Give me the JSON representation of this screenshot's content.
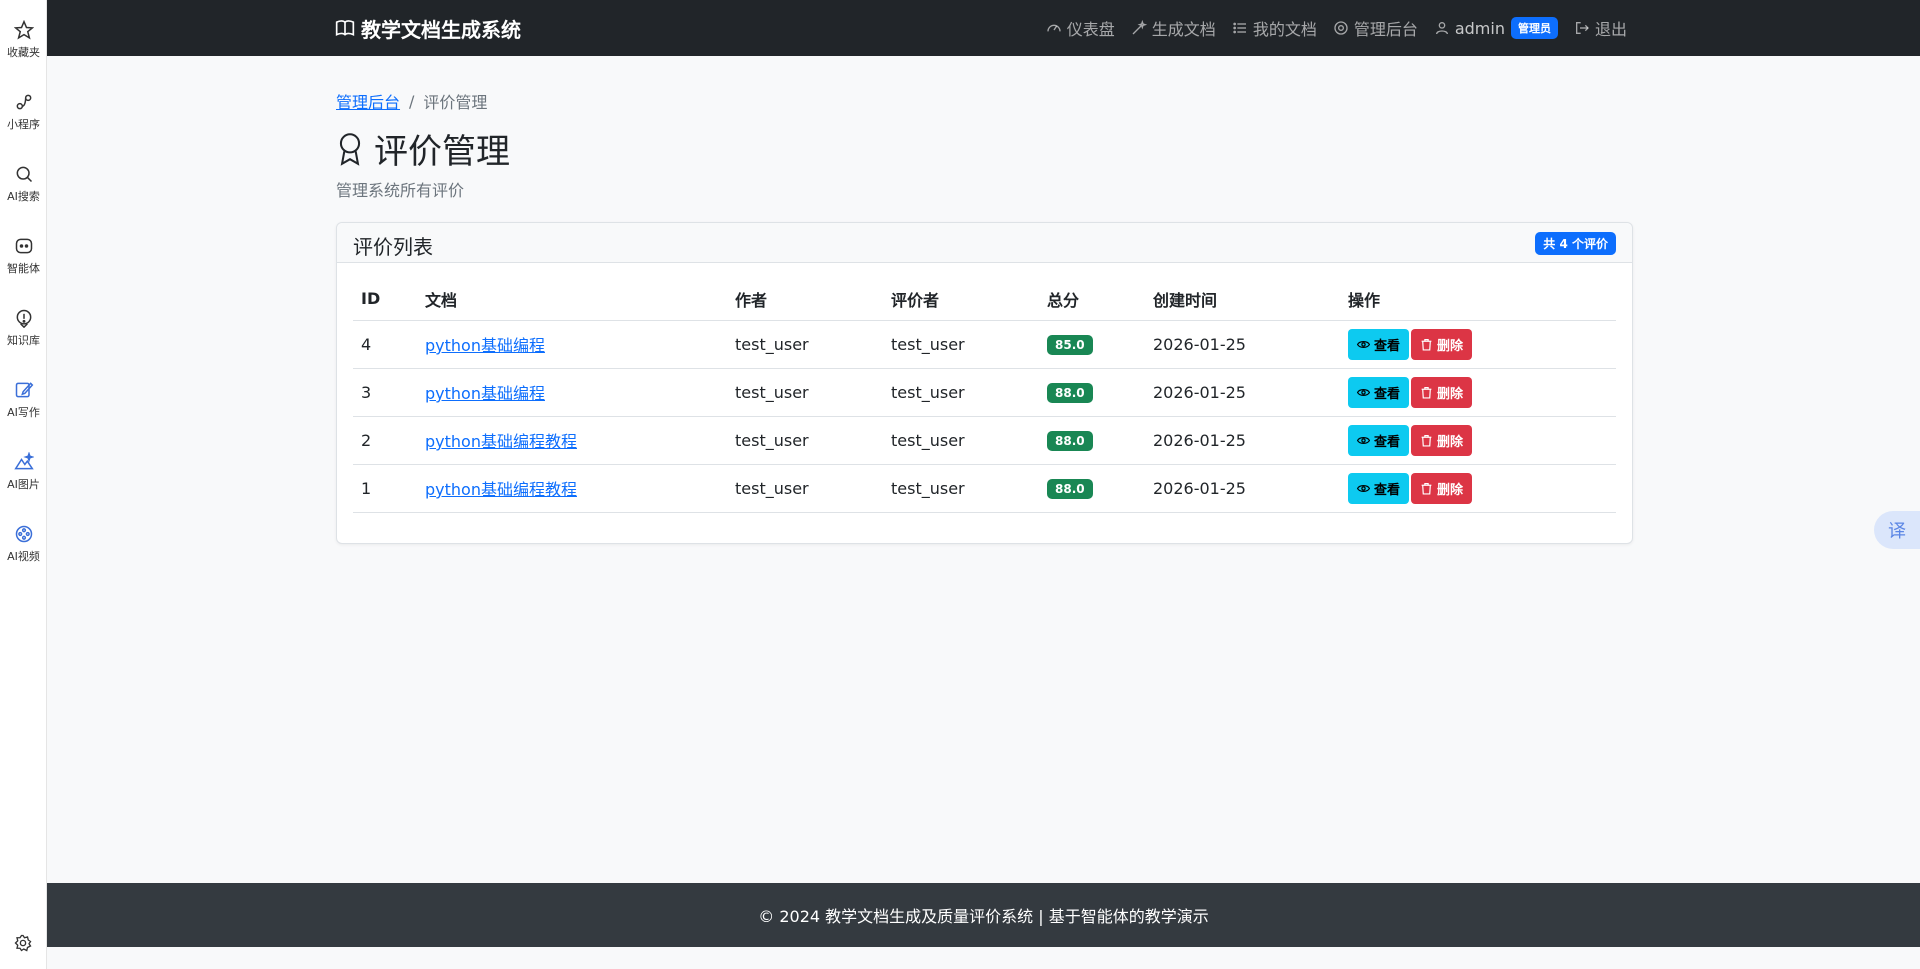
{
  "sidebar": {
    "items": [
      {
        "label": "收藏夹",
        "icon": "star-icon"
      },
      {
        "label": "小程序",
        "icon": "mini-program-icon"
      },
      {
        "label": "AI搜索",
        "icon": "search-icon"
      },
      {
        "label": "智能体",
        "icon": "agent-icon"
      },
      {
        "label": "知识库",
        "icon": "knowledge-icon"
      },
      {
        "label": "AI写作",
        "icon": "write-icon"
      },
      {
        "label": "AI图片",
        "icon": "image-icon"
      },
      {
        "label": "AI视频",
        "icon": "video-icon"
      }
    ],
    "settings_icon": "gear-icon"
  },
  "navbar": {
    "brand": "教学文档生成系统",
    "links": {
      "dashboard": "仪表盘",
      "generate": "生成文档",
      "my_docs": "我的文档",
      "admin": "管理后台",
      "user": "admin",
      "role": "管理员",
      "logout": "退出"
    }
  },
  "breadcrumb": {
    "parent": "管理后台",
    "separator": "/",
    "current": "评价管理"
  },
  "page": {
    "title": "评价管理",
    "subtitle": "管理系统所有评价"
  },
  "card": {
    "title": "评价列表",
    "count_badge": "共 4 个评价"
  },
  "table": {
    "headers": [
      "ID",
      "文档",
      "作者",
      "评价者",
      "总分",
      "创建时间",
      "操作"
    ],
    "rows": [
      {
        "id": "4",
        "doc": "python基础编程",
        "author": "test_user",
        "reviewer": "test_user",
        "score": "85.0",
        "created": "2026-01-25"
      },
      {
        "id": "3",
        "doc": "python基础编程",
        "author": "test_user",
        "reviewer": "test_user",
        "score": "88.0",
        "created": "2026-01-25"
      },
      {
        "id": "2",
        "doc": "python基础编程教程",
        "author": "test_user",
        "reviewer": "test_user",
        "score": "88.0",
        "created": "2026-01-25"
      },
      {
        "id": "1",
        "doc": "python基础编程教程",
        "author": "test_user",
        "reviewer": "test_user",
        "score": "88.0",
        "created": "2026-01-25"
      }
    ],
    "view_label": "查看",
    "delete_label": "删除"
  },
  "footer": {
    "text": "© 2024 教学文档生成及质量评价系统 | 基于智能体的教学演示"
  },
  "translate_button": "译",
  "colors": {
    "navbar": "#212529",
    "primary": "#0d6efd",
    "success": "#198754",
    "info": "#0dcaf0",
    "danger": "#dc3545",
    "footer": "#343a40"
  }
}
